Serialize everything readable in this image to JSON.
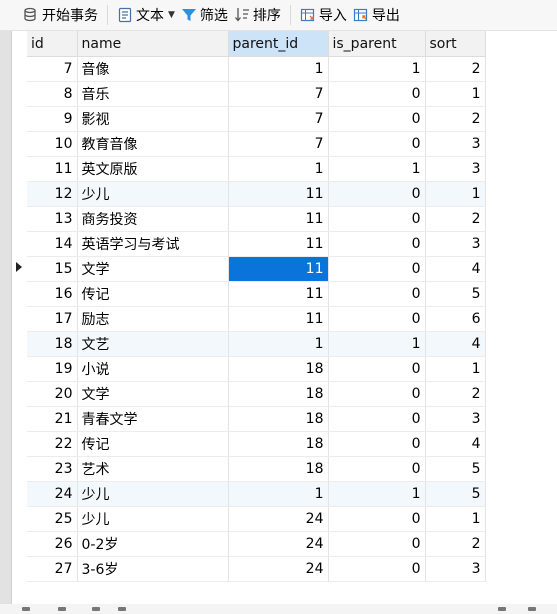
{
  "toolbar": {
    "begin_transaction": "开始事务",
    "text": "文本",
    "filter": "筛选",
    "sort": "排序",
    "import": "导入",
    "export": "导出"
  },
  "icons": [
    "transaction-icon",
    "text-icon",
    "filter-icon",
    "sort-icon",
    "import-icon",
    "export-icon"
  ],
  "colors": {
    "selected_cell": "#0a74da",
    "alt_row": "#f3f8fd",
    "header_selected": "#cde3f7"
  },
  "columns": [
    "id",
    "name",
    "parent_id",
    "is_parent",
    "sort"
  ],
  "selected_column": "parent_id",
  "current_row_id": "15",
  "rows": [
    {
      "id": "7",
      "name": "音像",
      "parent_id": "1",
      "is_parent": "1",
      "sort": "2"
    },
    {
      "id": "8",
      "name": "音乐",
      "parent_id": "7",
      "is_parent": "0",
      "sort": "1"
    },
    {
      "id": "9",
      "name": "影视",
      "parent_id": "7",
      "is_parent": "0",
      "sort": "2"
    },
    {
      "id": "10",
      "name": "教育音像",
      "parent_id": "7",
      "is_parent": "0",
      "sort": "3"
    },
    {
      "id": "11",
      "name": "英文原版",
      "parent_id": "1",
      "is_parent": "1",
      "sort": "3"
    },
    {
      "id": "12",
      "name": "少儿",
      "parent_id": "11",
      "is_parent": "0",
      "sort": "1"
    },
    {
      "id": "13",
      "name": "商务投资",
      "parent_id": "11",
      "is_parent": "0",
      "sort": "2"
    },
    {
      "id": "14",
      "name": "英语学习与考试",
      "parent_id": "11",
      "is_parent": "0",
      "sort": "3"
    },
    {
      "id": "15",
      "name": "文学",
      "parent_id": "11",
      "is_parent": "0",
      "sort": "4"
    },
    {
      "id": "16",
      "name": "传记",
      "parent_id": "11",
      "is_parent": "0",
      "sort": "5"
    },
    {
      "id": "17",
      "name": "励志",
      "parent_id": "11",
      "is_parent": "0",
      "sort": "6"
    },
    {
      "id": "18",
      "name": "文艺",
      "parent_id": "1",
      "is_parent": "1",
      "sort": "4"
    },
    {
      "id": "19",
      "name": "小说",
      "parent_id": "18",
      "is_parent": "0",
      "sort": "1"
    },
    {
      "id": "20",
      "name": "文学",
      "parent_id": "18",
      "is_parent": "0",
      "sort": "2"
    },
    {
      "id": "21",
      "name": "青春文学",
      "parent_id": "18",
      "is_parent": "0",
      "sort": "3"
    },
    {
      "id": "22",
      "name": "传记",
      "parent_id": "18",
      "is_parent": "0",
      "sort": "4"
    },
    {
      "id": "23",
      "name": "艺术",
      "parent_id": "18",
      "is_parent": "0",
      "sort": "5"
    },
    {
      "id": "24",
      "name": "少儿",
      "parent_id": "1",
      "is_parent": "1",
      "sort": "5"
    },
    {
      "id": "25",
      "name": "少儿",
      "parent_id": "24",
      "is_parent": "0",
      "sort": "1"
    },
    {
      "id": "26",
      "name": "0-2岁",
      "parent_id": "24",
      "is_parent": "0",
      "sort": "2"
    },
    {
      "id": "27",
      "name": "3-6岁",
      "parent_id": "24",
      "is_parent": "0",
      "sort": "3"
    }
  ]
}
